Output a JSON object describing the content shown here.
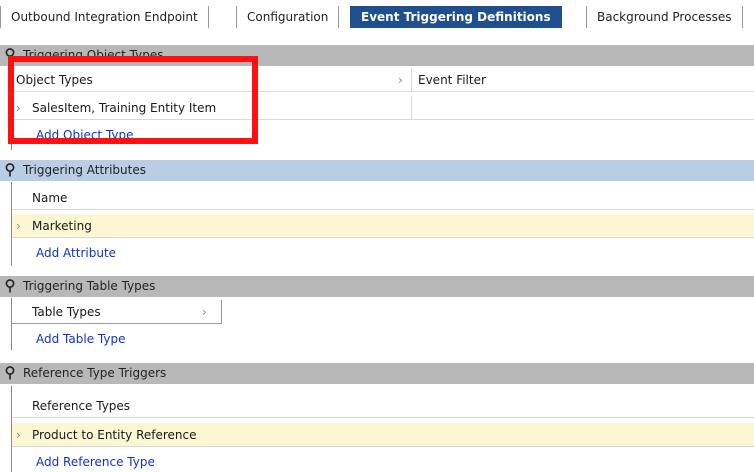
{
  "tabs": [
    {
      "label": "Outbound Integration Endpoint"
    },
    {
      "label": "Configuration"
    },
    {
      "label": "Event Triggering Definitions"
    },
    {
      "label": "Background Processes"
    }
  ],
  "sections": {
    "object_types": {
      "title": "Triggering Object Types",
      "col_object_types": "Object Types",
      "col_event_filter": "Event Filter",
      "row_value": "SalesItem, Training Entity Item",
      "add_label": "Add Object Type"
    },
    "attributes": {
      "title": "Triggering Attributes",
      "col_name": "Name",
      "row_value": "Marketing",
      "add_label": "Add Attribute"
    },
    "table_types": {
      "title": "Triggering Table Types",
      "col_table_types": "Table Types",
      "add_label": "Add Table Type"
    },
    "reference_triggers": {
      "title": "Reference Type Triggers",
      "col_reference_types": "Reference Types",
      "row_value": "Product to Entity Reference",
      "add_label": "Add Reference Type"
    }
  },
  "icons": {
    "pin": "pin-icon",
    "expand": "chevron-right-icon"
  },
  "colors": {
    "active_tab": "#1f4f8f",
    "section_header_gray": "#b8b8b8",
    "section_header_blue": "#b9cde5",
    "row_highlight": "#fbf7d2",
    "link": "#1133cc",
    "annotation": "#ff1111"
  }
}
